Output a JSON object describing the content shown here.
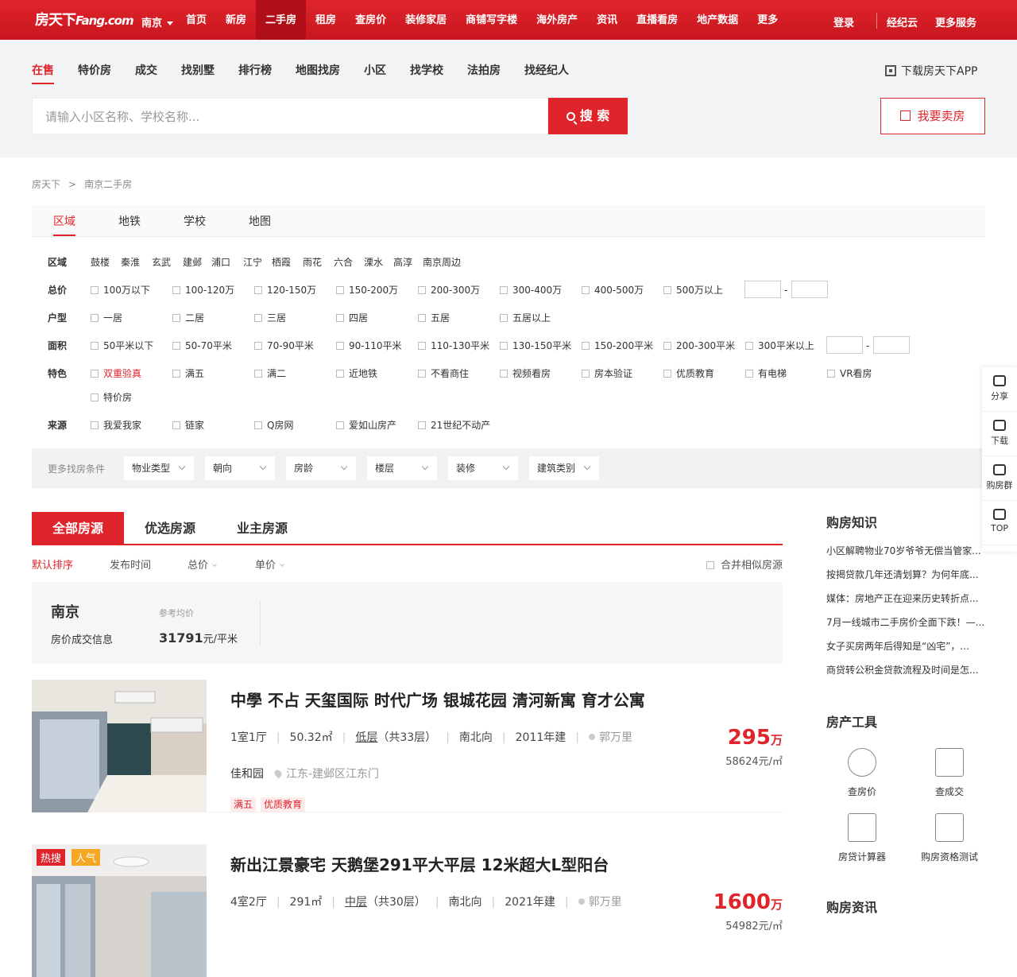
{
  "topbar": {
    "logo": "房天下",
    "logo_en": "Fang.com",
    "city": "南京",
    "nav": [
      "首页",
      "新房",
      "二手房",
      "租房",
      "查房价",
      "装修家居",
      "商铺写字楼",
      "海外房产",
      "资讯",
      "直播看房",
      "地产数据",
      "更多"
    ],
    "active": 2,
    "login": "登录",
    "agent_cloud": "经纪云",
    "more_services": "更多服务"
  },
  "subnav": {
    "items": [
      "在售",
      "特价房",
      "成交",
      "找别墅",
      "排行榜",
      "地图找房",
      "小区",
      "找学校",
      "法拍房",
      "找经纪人"
    ],
    "active": 0,
    "app_label": "下载房天下APP"
  },
  "search": {
    "placeholder": "请输入小区名称、学校名称...",
    "button": "搜 索",
    "sell_button": "我要卖房"
  },
  "breadcrumb": [
    "房天下",
    ">",
    "南京二手房"
  ],
  "filter": {
    "tabs": [
      "区域",
      "地铁",
      "学校",
      "地图"
    ],
    "active_tab": 0,
    "district_label": "区域",
    "districts": [
      "鼓楼",
      "秦淮",
      "玄武",
      "建邺",
      "浦口",
      "江宁",
      "栖霞",
      "雨花",
      "六合",
      "溧水",
      "高淳",
      "南京周边"
    ],
    "price_label": "总价",
    "prices": [
      "100万以下",
      "100-120万",
      "120-150万",
      "150-200万",
      "200-300万",
      "300-400万",
      "400-500万",
      "500万以上"
    ],
    "layout_label": "户型",
    "layouts": [
      "一居",
      "二居",
      "三居",
      "四居",
      "五居",
      "五居以上"
    ],
    "area_label": "面积",
    "areas": [
      "50平米以下",
      "50-70平米",
      "70-90平米",
      "90-110平米",
      "110-130平米",
      "130-150平米",
      "150-200平米",
      "200-300平米",
      "300平米以上"
    ],
    "feature_label": "特色",
    "features": [
      "双重验真",
      "满五",
      "满二",
      "近地铁",
      "不看商住",
      "视频看房",
      "房本验证",
      "优质教育",
      "有电梯",
      "VR看房",
      "特价房"
    ],
    "source_label": "来源",
    "sources": [
      "我爱我家",
      "链家",
      "Q房网",
      "爱如山房产",
      "21世纪不动产"
    ],
    "range_sep": "-",
    "more_label": "更多找房条件",
    "more": [
      "物业类型",
      "朝向",
      "房龄",
      "楼层",
      "装修",
      "建筑类别"
    ]
  },
  "list": {
    "tabs": [
      "全部房源",
      "优选房源",
      "业主房源"
    ],
    "active_tab": 0,
    "sorts": [
      "默认排序",
      "发布时间",
      "总价",
      "单价"
    ],
    "merge_label": "合并相似房源"
  },
  "pricebox": {
    "city": "南京",
    "info": "房价成交信息",
    "ref_label": "参考均价",
    "value": "31791",
    "unit": "元/平米"
  },
  "listings": [
    {
      "title": "中學 不占 天玺国际 时代广场 银城花园 清河新寓 育才公寓",
      "rooms": "1室1厅",
      "area": "50.32㎡",
      "floor": "低层",
      "floor_total": "（共33层）",
      "orient": "南北向",
      "year": "2011年建",
      "agent": "郭万里",
      "community": "佳和园",
      "location": "江东-建邺区江东门",
      "tags": [
        "满五",
        "优质教育"
      ],
      "price": "295",
      "price_unit": "万",
      "unit_price": "58624元/㎡"
    },
    {
      "title": "新出江景豪宅 天鹅堡291平大平层 12米超大L型阳台",
      "rooms": "4室2厅",
      "area": "291㎡",
      "floor": "中层",
      "floor_total": "（共30层）",
      "orient": "南北向",
      "year": "2021年建",
      "agent": "郭万里",
      "badges": [
        "热搜",
        "人气"
      ],
      "price": "1600",
      "price_unit": "万",
      "unit_price": "54982元/㎡"
    }
  ],
  "sidebar": {
    "knowledge_title": "购房知识",
    "knowledge": [
      "小区解聘物业70岁爷爷无偿当管家...",
      "按揭贷款几年还清划算？为何年底...",
      "媒体：房地产正在迎来历史转折点...",
      "7月一线城市二手房价全面下跌！—...",
      "女子买房两年后得知是“凶宅”，...",
      "商贷转公积金贷款流程及时间是怎..."
    ],
    "tools_title": "房产工具",
    "tools": [
      "查房价",
      "查成交",
      "房贷计算器",
      "购房资格测试"
    ],
    "news_title": "购房资讯"
  },
  "float": [
    "分享",
    "下载",
    "购房群",
    "TOP"
  ],
  "colors": {
    "brand": "#e0242c"
  }
}
